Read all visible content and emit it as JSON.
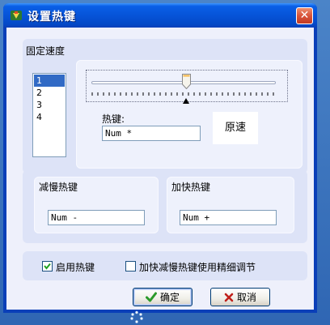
{
  "window": {
    "title": "设置热键",
    "close_glyph": "✕"
  },
  "fixed_speed": {
    "header": "固定速度",
    "speed_list": [
      "1",
      "2",
      "3",
      "4"
    ],
    "selected_index": 0,
    "slider_level": 0.5,
    "hotkey_label": "热键:",
    "hotkey_value": "Num *",
    "reset_label": "原速"
  },
  "slow_down": {
    "header": "减慢热键",
    "value": "Num -"
  },
  "speed_up": {
    "header": "加快热键",
    "value": "Num +"
  },
  "options": {
    "enable_hotkey_label": "启用热键",
    "enable_hotkey_checked": true,
    "fine_tune_label": "加快减慢热键使用精细调节",
    "fine_tune_checked": false
  },
  "buttons": {
    "ok_label": "确定",
    "cancel_label": "取消"
  },
  "colors": {
    "title_bar": "#0a5fe6",
    "selection": "#316ac5",
    "close": "#d9543a",
    "ok_check": "#2a9a2a",
    "cancel_x": "#c0201a"
  }
}
